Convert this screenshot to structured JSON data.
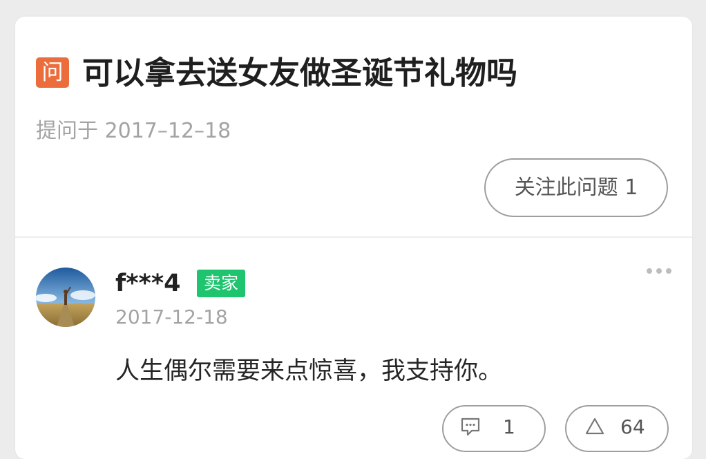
{
  "question": {
    "badge": "问",
    "title": "可以拿去送女友做圣诞节礼物吗",
    "asked_date": "提问于 2017–12–18",
    "follow_button": "关注此问题 1"
  },
  "answer": {
    "username": "f***4",
    "seller_badge": "卖家",
    "date": "2017-12-18",
    "text": "人生偶尔需要来点惊喜，我支持你。",
    "comment_count": "1",
    "like_count": "64"
  },
  "colors": {
    "question_badge": "#ec6d3c",
    "seller_badge": "#1fc46f"
  },
  "icons": {
    "question": "question-badge",
    "more": "more-dots-icon",
    "comment": "comment-icon",
    "like": "triangle-up-icon"
  }
}
